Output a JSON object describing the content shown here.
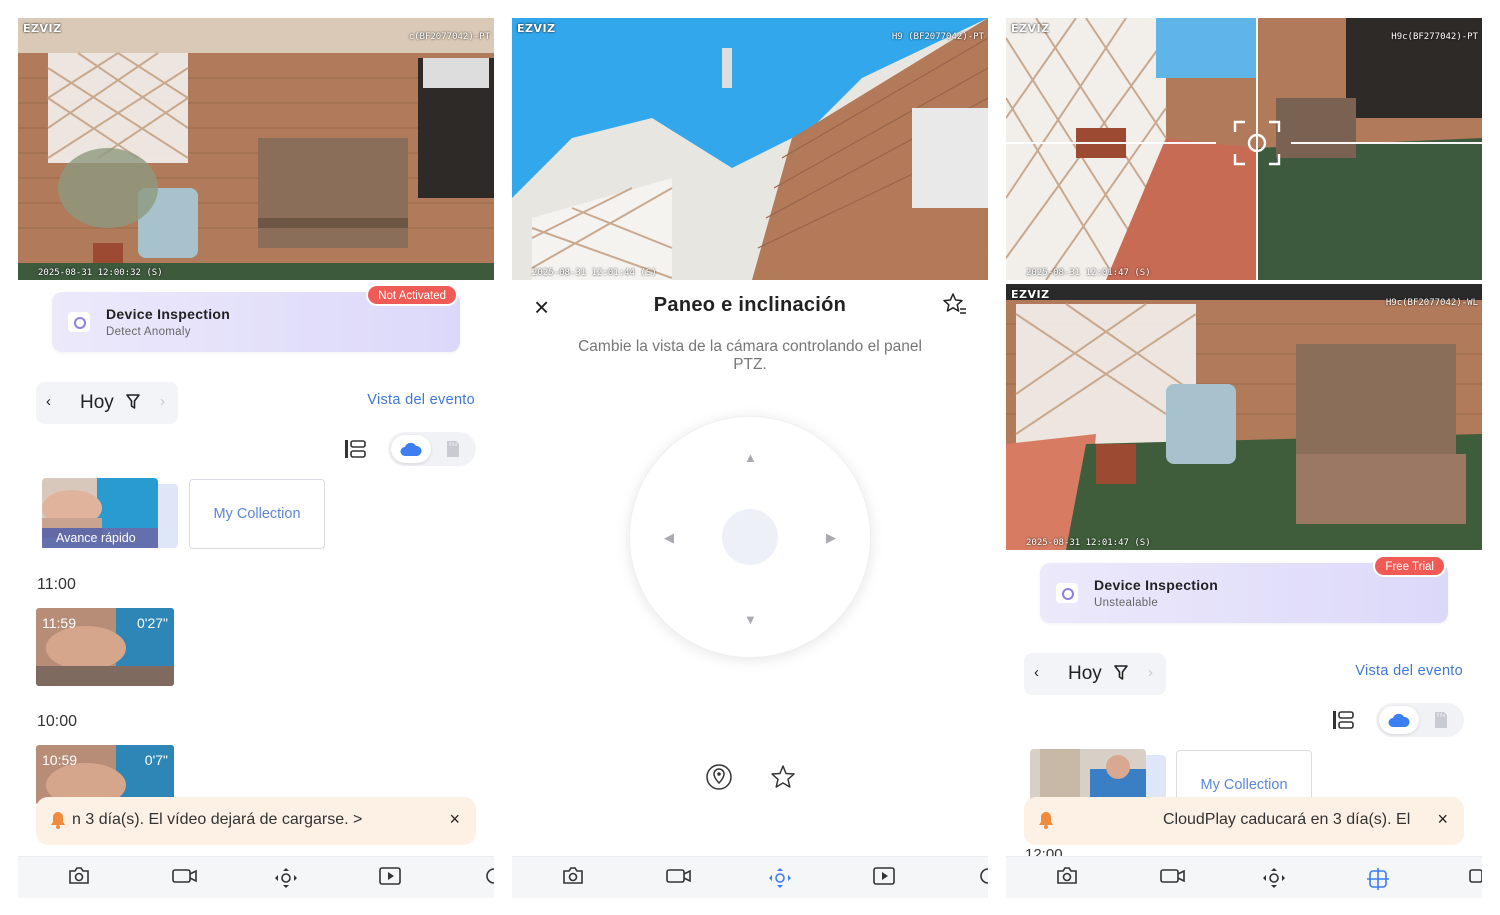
{
  "brand": "EZVIZ",
  "panel1": {
    "feed": {
      "osd_id": "c(BF2077042)-PT",
      "osd_time": "2025-08-31 12:00:32 (S)"
    },
    "inspection": {
      "title": "Device Inspection",
      "subtitle": "Detect Anomaly",
      "badge": "Not Activated"
    },
    "date_nav": {
      "prev": "‹",
      "day": "Hoy",
      "next": "›"
    },
    "event_link": "Vista del evento",
    "fast_forward_label": "Avance rápido",
    "my_collection": "My Collection",
    "groups": [
      {
        "hour": "11:00",
        "clip_time": "11:59",
        "clip_duration": "0'27\""
      },
      {
        "hour": "10:00",
        "clip_time": "10:59",
        "clip_duration": "0'7\""
      }
    ],
    "banner": {
      "message": "n 3 día(s). El vídeo dejará de cargarse. >",
      "close": "×"
    }
  },
  "panel2": {
    "feed": {
      "osd_id": "H9 (BF2077042)-PT",
      "osd_time": "2025-08-31 12:01:44 (S)"
    },
    "close": "×",
    "title": "Paneo e inclinación",
    "description": "Cambie la vista de la cámara controlando el panel PTZ.",
    "arrows": {
      "up": "▲",
      "down": "▼",
      "left": "◀",
      "right": "▶"
    }
  },
  "panel3": {
    "feed_top": {
      "osd_id": "H9c(BF277042)-PT",
      "osd_time": "2025-08-31 12:01:47 (S)"
    },
    "feed_bottom": {
      "osd_id": "H9c(BF2077042)-WL",
      "osd_time": "2025-08-31 12:01:47 (S)"
    },
    "inspection": {
      "title": "Device Inspection",
      "subtitle": "Unstealable",
      "badge": "Free Trial"
    },
    "date_nav": {
      "prev": "‹",
      "day": "Hoy",
      "next": "›"
    },
    "event_link": "Vista del evento",
    "my_collection": "My Collection",
    "banner": {
      "message": "CloudPlay caducará en 3 día(s). El",
      "close": "×"
    },
    "next_hour": "12:00"
  },
  "colors": {
    "accent": "#3f78d8",
    "badge_red": "#f05b55",
    "cloud_blue": "#3d7ef0",
    "banner_bg": "#fdf0e4",
    "bell_orange": "#f08a3c"
  },
  "icons": [
    "camera-icon",
    "record-icon",
    "ptz-icon",
    "playback-icon",
    "filter-icon",
    "cloud-icon",
    "sd-card-icon",
    "list-view-icon",
    "bell-icon",
    "star-icon",
    "location-icon",
    "crosshair-icon"
  ]
}
